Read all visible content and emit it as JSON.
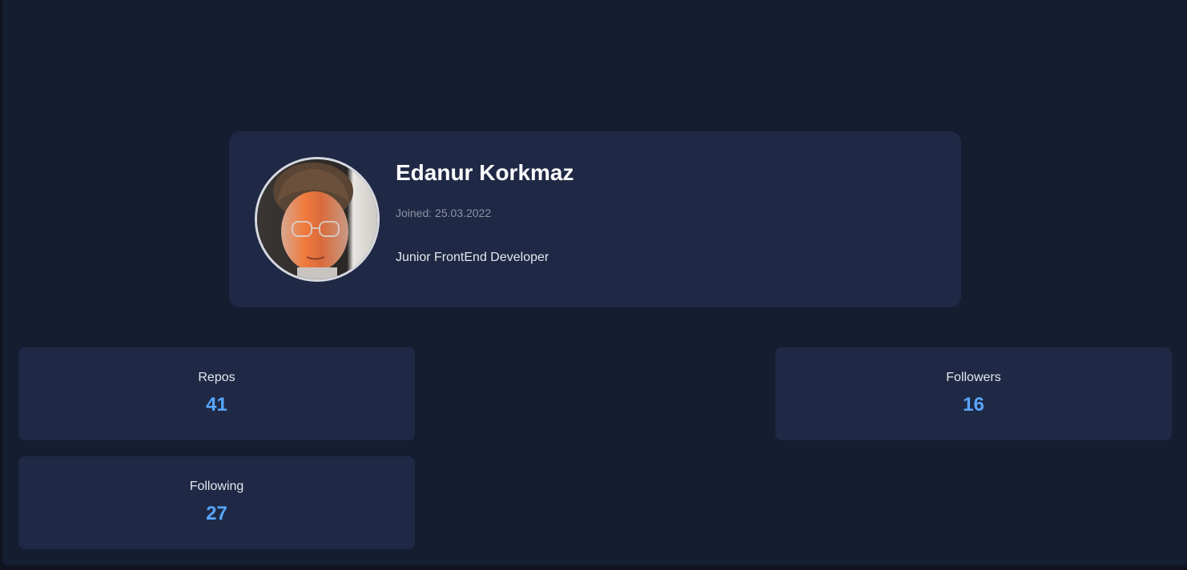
{
  "profile": {
    "name": "Edanur Korkmaz",
    "joined": "Joined: 25.03.2022",
    "bio": "Junior FrontEnd Developer"
  },
  "stats": {
    "repos": {
      "label": "Repos",
      "value": "41"
    },
    "followers": {
      "label": "Followers",
      "value": "16"
    },
    "following": {
      "label": "Following",
      "value": "27"
    }
  },
  "colors": {
    "page_background": "#151d30",
    "card_background": "#1f2945",
    "accent": "#58a6ff",
    "name_text": "#ffffff",
    "muted_text": "#8c93a3"
  }
}
